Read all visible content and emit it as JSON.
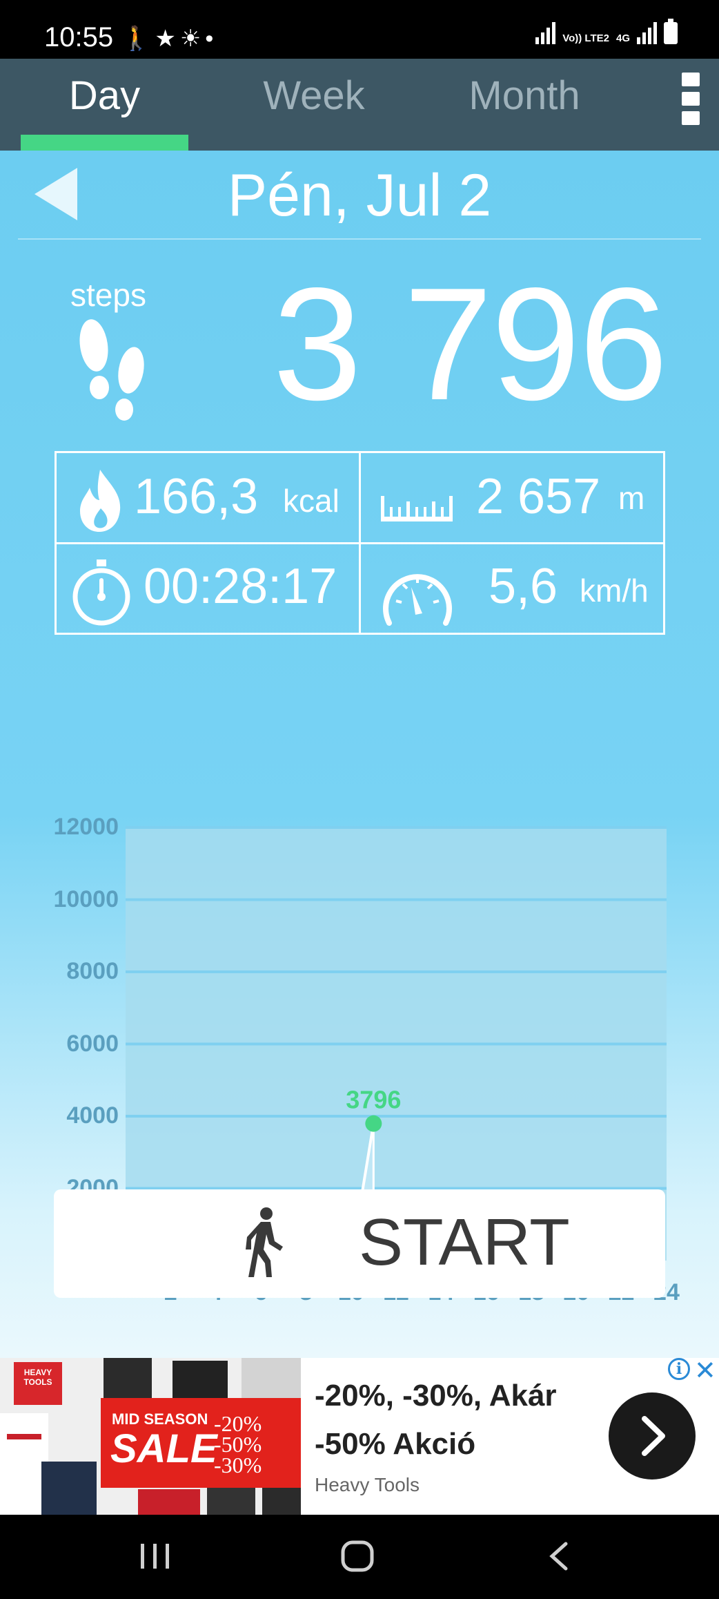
{
  "status_bar": {
    "time": "10:55",
    "network_label": "Vo)) LTE2",
    "network_type": "4G",
    "icons": [
      "walking-icon",
      "star-icon",
      "sunrise-icon",
      "dot-icon",
      "signal-icon",
      "battery-icon"
    ]
  },
  "tabs": [
    {
      "label": "Day",
      "active": true
    },
    {
      "label": "Week",
      "active": false
    },
    {
      "label": "Month",
      "active": false
    }
  ],
  "date": "Pén, Jul 2",
  "steps": {
    "label": "steps",
    "value": "3 796"
  },
  "stats": {
    "calories": {
      "value": "166,3",
      "unit": "kcal"
    },
    "distance": {
      "value": "2 657",
      "unit": "m"
    },
    "duration": {
      "value": "00:28:17"
    },
    "speed": {
      "value": "5,6",
      "unit": "km/h"
    }
  },
  "chart_data": {
    "type": "line",
    "x": [
      0,
      1,
      2,
      3,
      4,
      5,
      6,
      7,
      8,
      9,
      10,
      11
    ],
    "values": [
      0,
      0,
      0,
      0,
      0,
      0,
      0,
      0,
      0,
      0,
      0,
      3796
    ],
    "highlight": {
      "x": 11,
      "value": 3796,
      "label": "3796"
    },
    "yticks": [
      "12000",
      "10000",
      "8000",
      "6000",
      "4000",
      "2000"
    ],
    "xticks": [
      "2",
      "4",
      "6",
      "8",
      "10",
      "12",
      "14",
      "16",
      "18",
      "20",
      "22",
      "24"
    ],
    "xlim": [
      0,
      24
    ],
    "ylim": [
      0,
      12000
    ],
    "grid": true,
    "colors": {
      "line": "#ffffff",
      "highlight": "#45d685",
      "plot_bg": "#a6dcef",
      "grid": "#7fd0f0"
    }
  },
  "start_button": {
    "label": "START"
  },
  "ad": {
    "title_line1": "-20%, -30%, Akár",
    "title_line2": "-50% Akció",
    "brand": "Heavy Tools",
    "image_logo": "HEAVY TOOLS",
    "image_tag": "MID SEASON",
    "image_sale": "SALE",
    "image_pct1": "-20%",
    "image_pct2": "-50%",
    "image_pct3": "-30%",
    "info_label": "i"
  },
  "colors": {
    "tabbar": "#3d5764",
    "accent": "#45d685",
    "main_bg": "#6ccdf1"
  }
}
